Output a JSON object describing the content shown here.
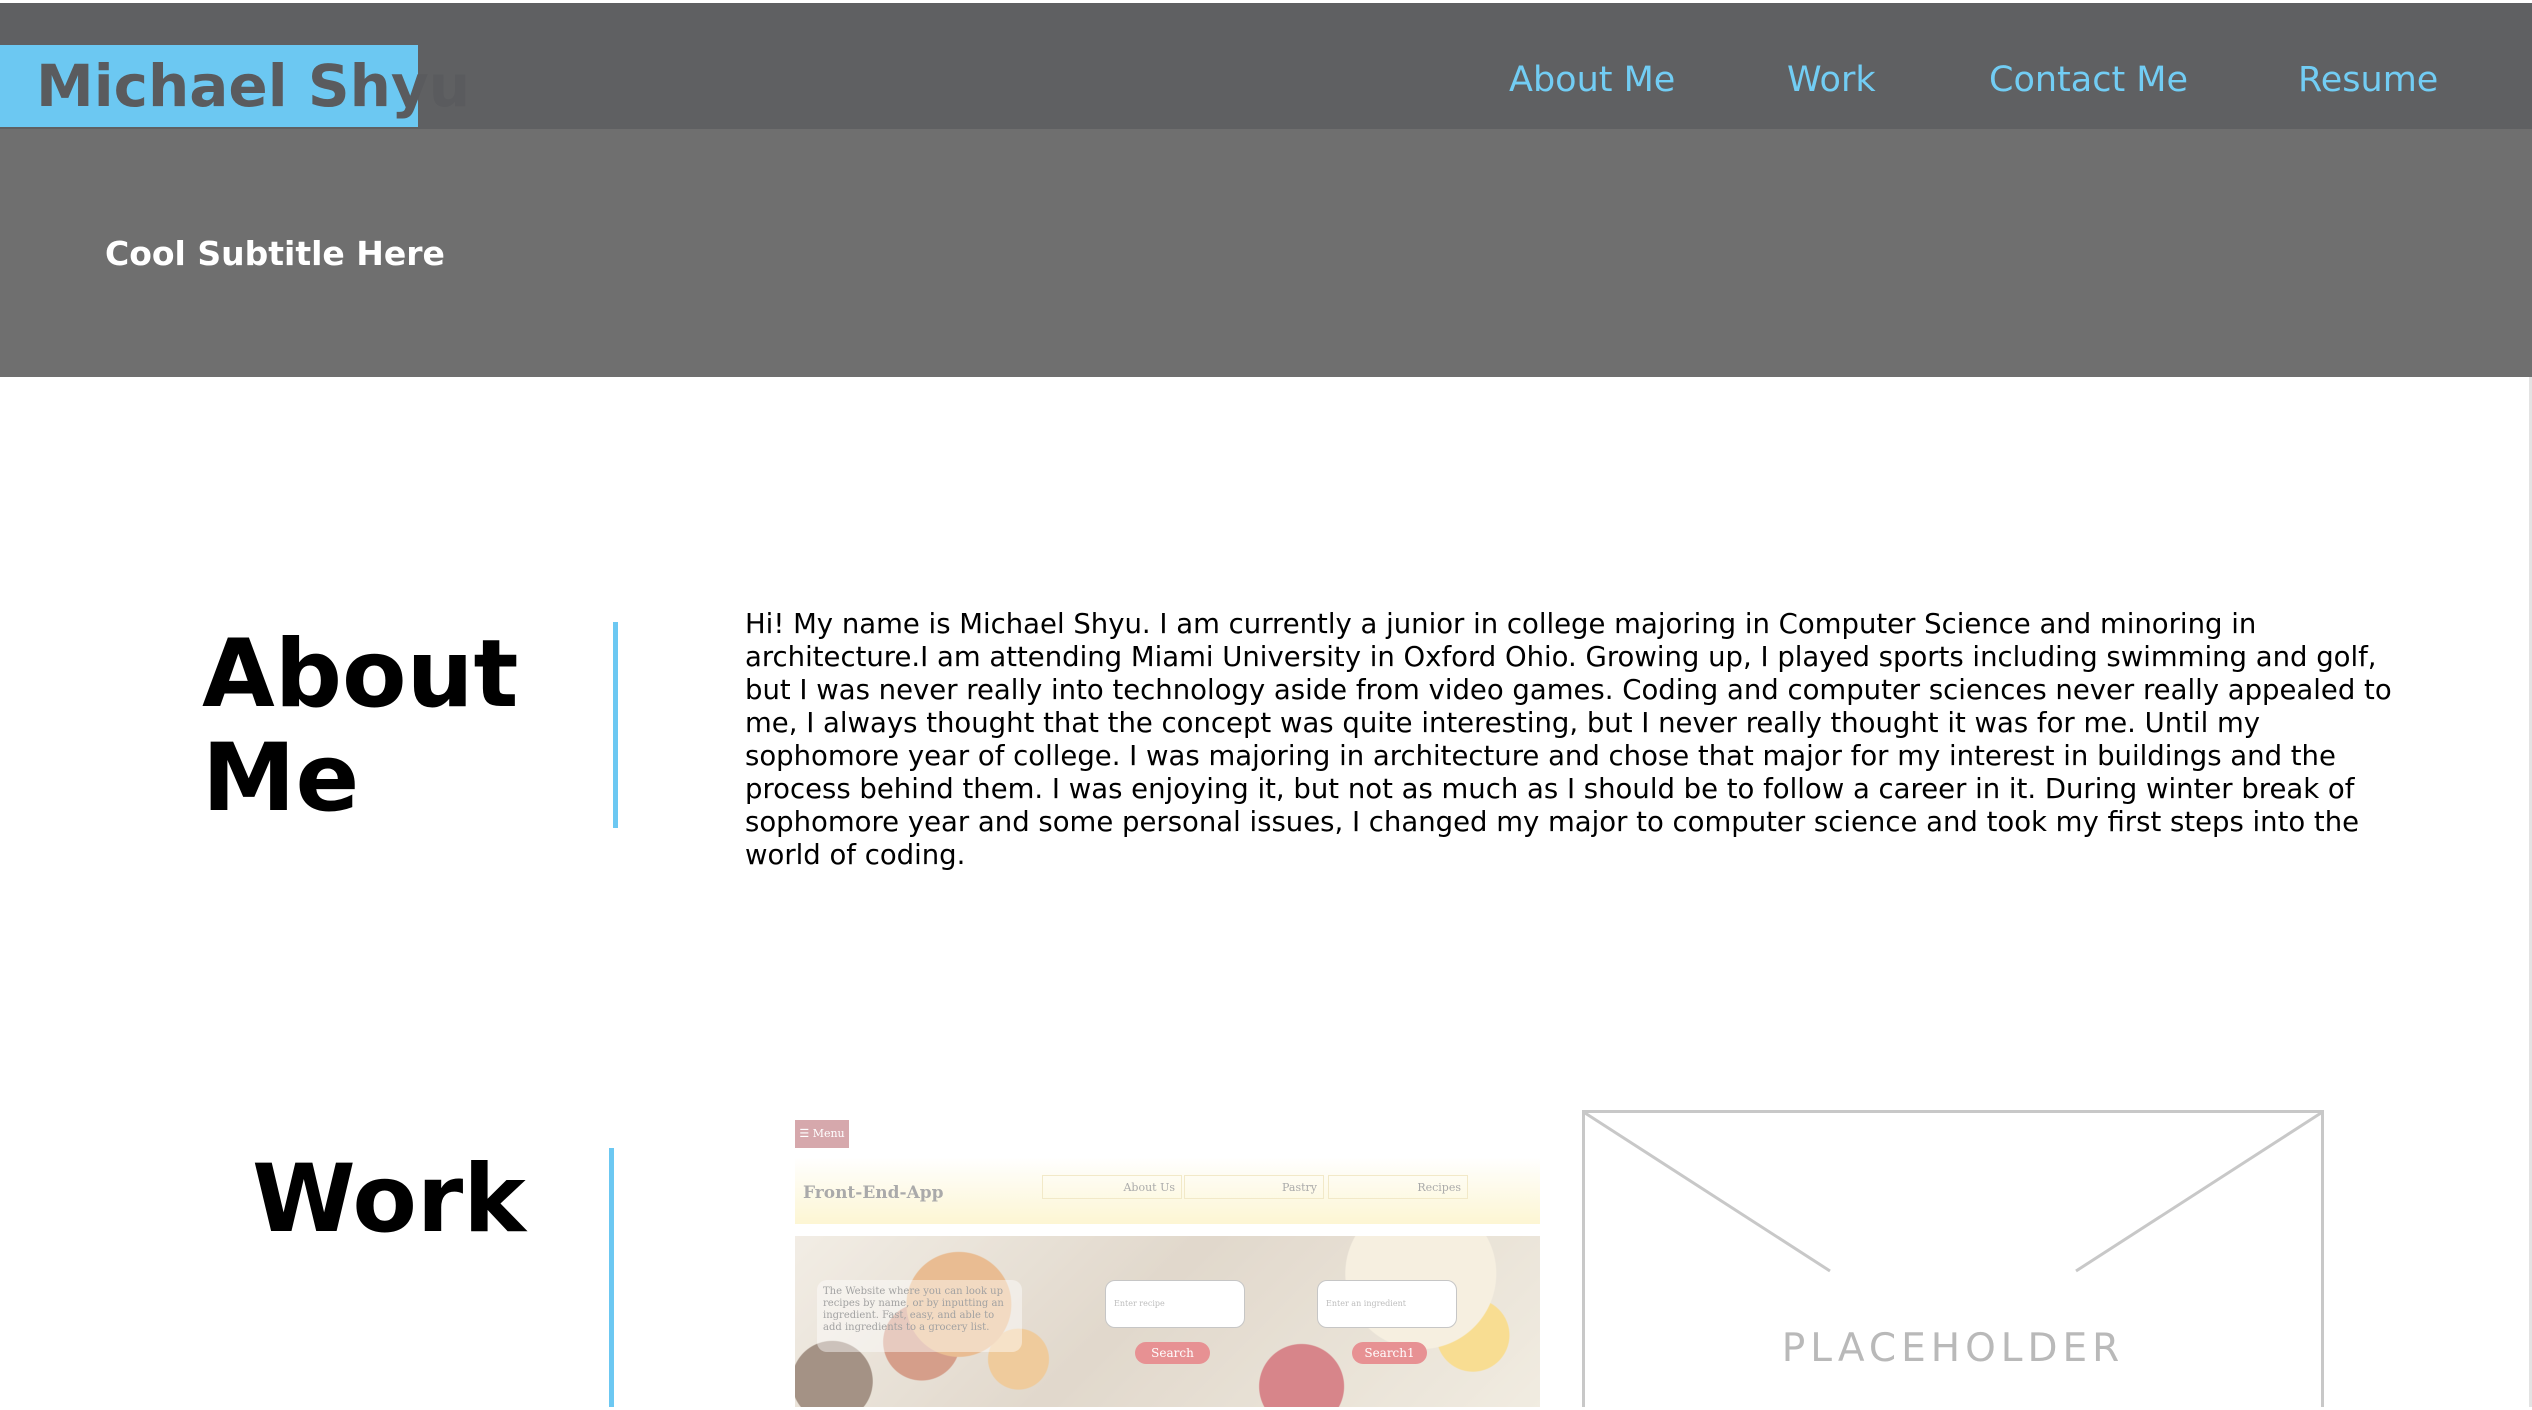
{
  "header": {
    "brand": "Michael Shyu",
    "nav": [
      {
        "label": "About Me"
      },
      {
        "label": "Work"
      },
      {
        "label": "Contact Me"
      },
      {
        "label": "Resume"
      }
    ]
  },
  "hero": {
    "subtitle": "Cool Subtitle Here"
  },
  "about": {
    "title": "About Me",
    "body": "Hi! My name is Michael Shyu. I am currently a junior in college majoring in Computer Science and minoring in architecture.I am attending Miami University in Oxford Ohio. Growing up, I played sports including swimming and golf, but I was never really into technology aside from video games. Coding and computer sciences never really appealed to me, I always thought that the concept was quite interesting, but I never really thought it was for me. Until my sophomore year of college. I was majoring in architecture and chose that major for my interest in buildings and the process behind them. I was enjoying it, but not as much as I should be to follow a career in it. During winter break of sophomore year and some personal issues, I changed my major to computer science and took my first steps into the world of coding."
  },
  "work": {
    "title": "Work",
    "projects": [
      {
        "menu_label": "☰ Menu",
        "app_title": "Front-End-App",
        "tabs": [
          "About Us",
          "Pastry",
          "Recipes"
        ],
        "description": "The Website where you can look up recipes by name, or by inputting an ingredient. Fast, easy, and able to add ingredients to a grocery list.",
        "inputs": [
          "Enter recipe",
          "Enter an ingredient"
        ],
        "buttons": [
          "Search",
          "Search1"
        ]
      }
    ],
    "placeholder_label": "PLACEHOLDER"
  },
  "colors": {
    "accent": "#6cc8f2",
    "nav_link": "#72cdf4",
    "navbar_bg": "#5f6062",
    "hero_bg": "#6f6f6f"
  }
}
